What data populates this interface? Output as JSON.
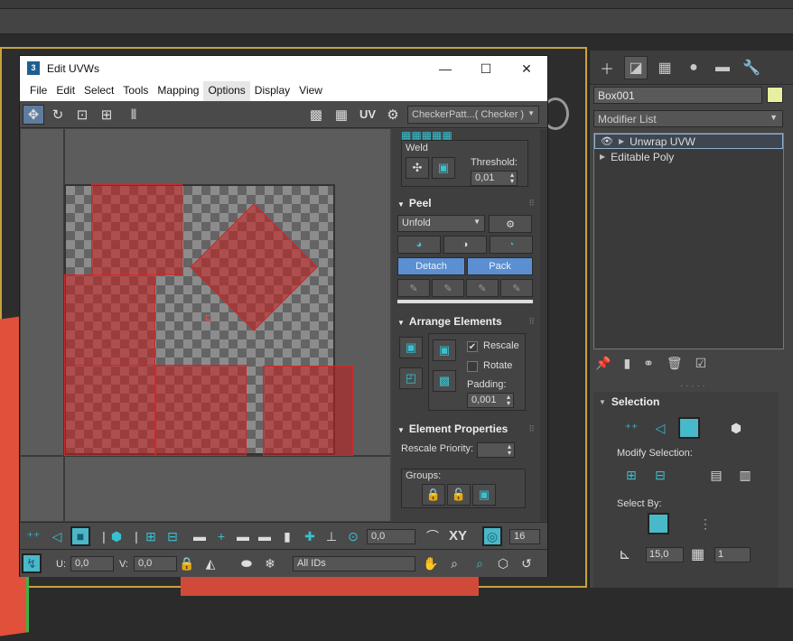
{
  "window": {
    "title": "Edit UVWs",
    "icon_label": "3",
    "minimize": "—",
    "maximize": "☐",
    "close": "✕"
  },
  "menu": [
    "File",
    "Edit",
    "Select",
    "Tools",
    "Mapping",
    "Options",
    "Display",
    "View"
  ],
  "toolbar": {
    "uv_label": "UV",
    "texture_dropdown": "CheckerPatt...( Checker )"
  },
  "weld": {
    "title": "Weld",
    "threshold_label": "Threshold:",
    "threshold_value": "0,01"
  },
  "peel": {
    "title": "Peel",
    "mode": "Unfold",
    "detach": "Detach",
    "pack": "Pack"
  },
  "arrange": {
    "title": "Arrange Elements",
    "rescale_label": "Rescale",
    "rescale_checked": true,
    "rotate_label": "Rotate",
    "rotate_checked": false,
    "padding_label": "Padding:",
    "padding_value": "0,001"
  },
  "element_props": {
    "title": "Element Properties",
    "rescale_priority_label": "Rescale Priority:",
    "rescale_priority_value": "",
    "groups_label": "Groups:"
  },
  "bottom_toolbar": {
    "angle_value": "0,0",
    "xy_label": "XY",
    "grid_value": "16",
    "u_label": "U:",
    "u_value": "0,0",
    "v_label": "V:",
    "v_value": "0,0",
    "ids_dropdown": "All IDs"
  },
  "command_panel": {
    "object_name": "Box001",
    "object_color": "#e6f0a0",
    "modifier_list": "Modifier List",
    "stack": [
      {
        "label": "Unwrap UVW",
        "selected": true,
        "eye": true
      },
      {
        "label": "Editable Poly",
        "selected": false,
        "eye": false
      }
    ],
    "selection_title": "Selection",
    "modify_selection_label": "Modify Selection:",
    "select_by_label": "Select By:",
    "angle_value": "15,0",
    "count_value": "1"
  },
  "colors": {
    "accent_blue": "#5b8fd2",
    "cyan_icon": "#39c0d0",
    "uv_shell": "#c81e1e",
    "viewport_border": "#c8a23a"
  }
}
